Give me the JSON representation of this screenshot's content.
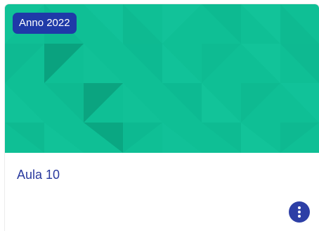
{
  "card": {
    "badge": "Anno 2022",
    "title": "Aula 10",
    "menu_icon": "more-vertical-icon",
    "banner_color": "#0fbf95",
    "badge_color": "#1f3aa8",
    "title_color": "#2a3a9e",
    "menu_color": "#2d3fa6"
  }
}
